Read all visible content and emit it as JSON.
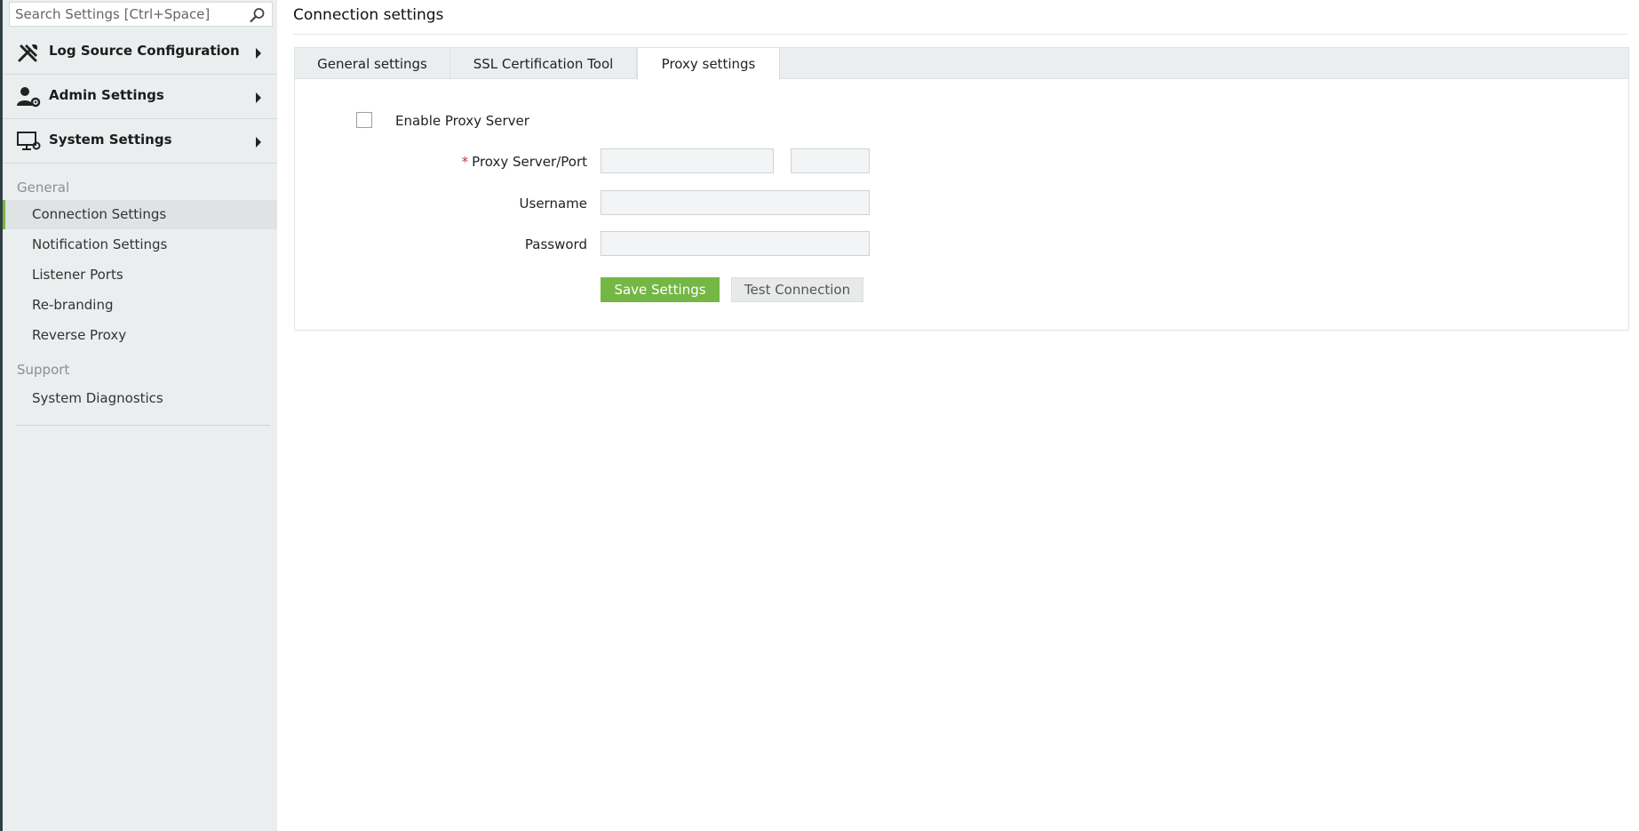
{
  "search": {
    "placeholder": "Search Settings [Ctrl+Space]"
  },
  "sidebar": {
    "menus": [
      {
        "label": "Log Source Configuration",
        "icon": "tools-icon"
      },
      {
        "label": "Admin Settings",
        "icon": "admin-gear-icon"
      },
      {
        "label": "System Settings",
        "icon": "monitor-settings-icon"
      }
    ],
    "sections": [
      {
        "heading": "General",
        "items": [
          "Connection Settings",
          "Notification Settings",
          "Listener Ports",
          "Re-branding",
          "Reverse Proxy"
        ]
      },
      {
        "heading": "Support",
        "items": [
          "System Diagnostics"
        ]
      }
    ],
    "active_item": "Connection Settings"
  },
  "page": {
    "title": "Connection settings"
  },
  "tabs": [
    {
      "label": "General settings"
    },
    {
      "label": "SSL Certification Tool"
    },
    {
      "label": "Proxy settings"
    }
  ],
  "active_tab": "Proxy settings",
  "form": {
    "enable_proxy_label": "Enable Proxy Server",
    "enable_proxy_checked": false,
    "required_marker": "*",
    "server_port_label": "Proxy Server/Port",
    "server_value": "",
    "port_value": "",
    "username_label": "Username",
    "username_value": "",
    "password_label": "Password",
    "password_value": "",
    "save_label": "Save Settings",
    "test_label": "Test Connection"
  },
  "colors": {
    "accent": "#74b744",
    "required": "#d32f2f",
    "sidebar_bg": "#eaeeef"
  }
}
